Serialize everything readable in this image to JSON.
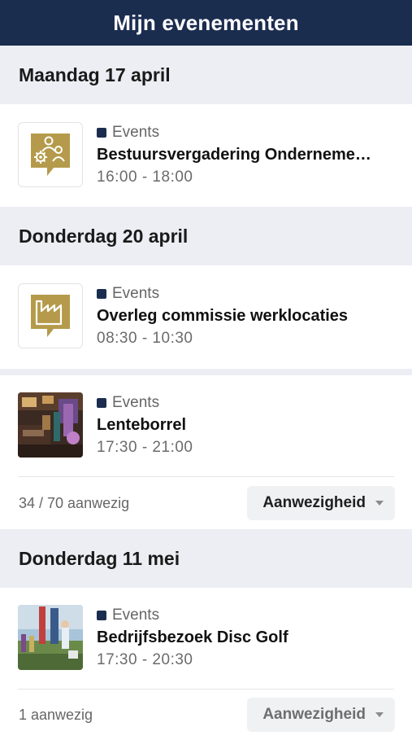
{
  "header": {
    "title": "Mijn evenementen"
  },
  "colors": {
    "header_bg": "#1b2d4f",
    "gold": "#b49a4a",
    "section_bg": "#eceef3"
  },
  "days": [
    {
      "label": "Maandag 17 april",
      "events": [
        {
          "category": "Events",
          "title": "Bestuursvergadering Onderneme…",
          "time": "16:00 - 18:00",
          "icon": "people-gear-icon"
        }
      ]
    },
    {
      "label": "Donderdag 20 april",
      "events": [
        {
          "category": "Events",
          "title": "Overleg commissie werklocaties",
          "time": "08:30 - 10:30",
          "icon": "factory-icon"
        },
        {
          "category": "Events",
          "title": "Lenteborrel",
          "time": "17:30 - 21:00",
          "icon": "photo-bar",
          "attendance": "34 / 70 aanwezig",
          "button": "Aanwezigheid"
        }
      ]
    },
    {
      "label": "Donderdag 11 mei",
      "events": [
        {
          "category": "Events",
          "title": "Bedrijfsbezoek Disc Golf",
          "time": "17:30 - 20:30",
          "icon": "photo-discgolf",
          "attendance": "1 aanwezig",
          "button": "Aanwezigheid"
        }
      ]
    }
  ]
}
